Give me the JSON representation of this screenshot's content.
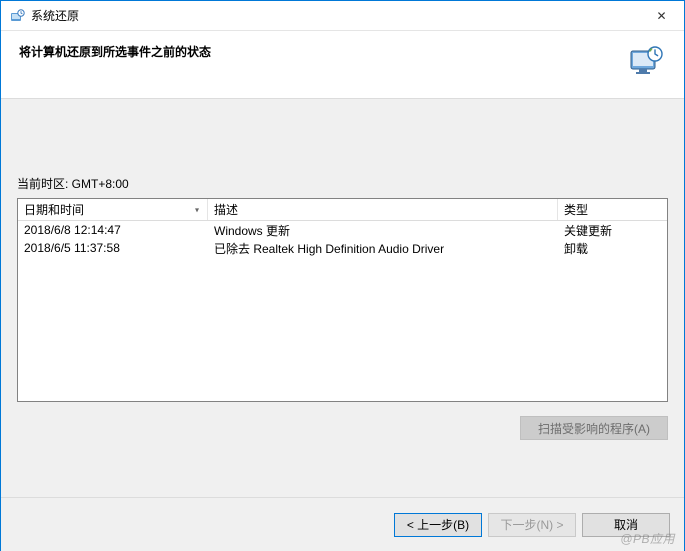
{
  "window": {
    "title": "系统还原",
    "close": "✕"
  },
  "header": {
    "heading": "将计算机还原到所选事件之前的状态"
  },
  "timezone": {
    "label": "当前时区: GMT+8:00"
  },
  "table": {
    "columns": {
      "date": "日期和时间",
      "desc": "描述",
      "type": "类型"
    },
    "rows": [
      {
        "date": "2018/6/8 12:14:47",
        "desc": "Windows 更新",
        "type": "关键更新"
      },
      {
        "date": "2018/6/5 11:37:58",
        "desc": "已除去 Realtek High Definition Audio Driver",
        "type": "卸载"
      }
    ]
  },
  "buttons": {
    "scan": "扫描受影响的程序(A)",
    "back": "< 上一步(B)",
    "next": "下一步(N) >",
    "cancel": "取消"
  },
  "watermark": "@PB应用"
}
